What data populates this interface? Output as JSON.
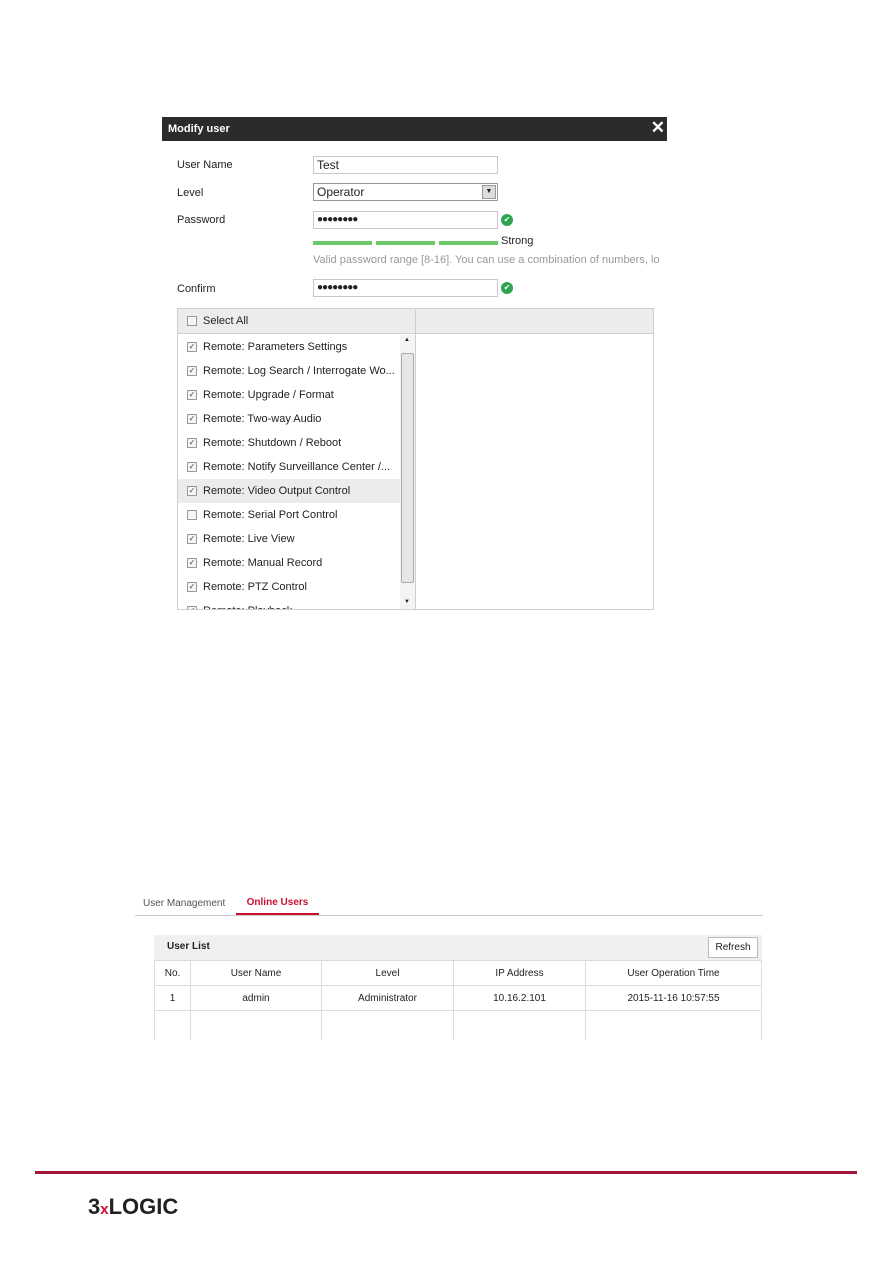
{
  "dialog": {
    "title": "Modify user",
    "close_icon": "close-icon",
    "fields": {
      "username_label": "User Name",
      "username_value": "Test",
      "level_label": "Level",
      "level_value": "Operator",
      "password_label": "Password",
      "password_value": "●●●●●●●●",
      "strength": "Strong",
      "hint": "Valid password range [8-16]. You can use a combination of numbers, lo",
      "confirm_label": "Confirm",
      "confirm_value": "●●●●●●●●"
    },
    "select_all": "Select All",
    "permissions": [
      {
        "label": "Remote: Parameters Settings",
        "checked": true
      },
      {
        "label": "Remote: Log Search / Interrogate Wo...",
        "checked": true
      },
      {
        "label": "Remote: Upgrade / Format",
        "checked": true
      },
      {
        "label": "Remote: Two-way Audio",
        "checked": true
      },
      {
        "label": "Remote: Shutdown / Reboot",
        "checked": true
      },
      {
        "label": "Remote: Notify Surveillance Center /...",
        "checked": true
      },
      {
        "label": "Remote: Video Output Control",
        "checked": true
      },
      {
        "label": "Remote: Serial Port Control",
        "checked": false
      },
      {
        "label": "Remote: Live View",
        "checked": true
      },
      {
        "label": "Remote: Manual Record",
        "checked": true
      },
      {
        "label": "Remote: PTZ Control",
        "checked": true
      },
      {
        "label": "Remote: Playback",
        "checked": true
      }
    ]
  },
  "online": {
    "tabs": [
      "User Management",
      "Online Users"
    ],
    "active_tab": "Online Users",
    "accent": "#c8102e",
    "list_title": "User List",
    "refresh": "Refresh",
    "columns": [
      "No.",
      "User Name",
      "Level",
      "IP Address",
      "User Operation Time"
    ],
    "rows": [
      [
        "1",
        "admin",
        "Administrator",
        "10.16.2.101",
        "2015-11-16 10:57:55"
      ]
    ]
  },
  "footer": {
    "logo": "3xLOGIC",
    "line_color": "#a0173a"
  }
}
